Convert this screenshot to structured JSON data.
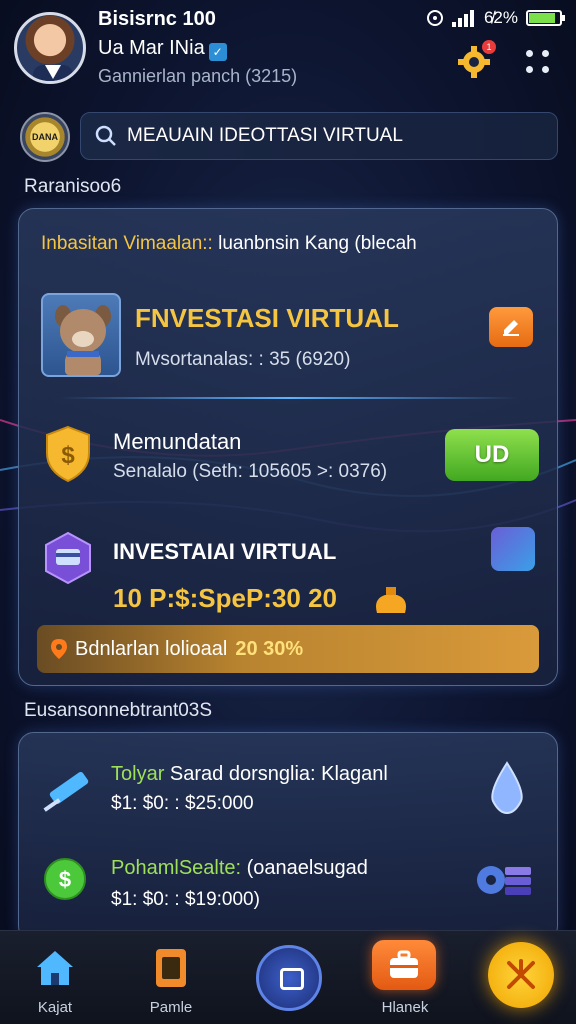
{
  "status_bar": {
    "signal_text": "6̸2%",
    "battery_level": 0.85
  },
  "header": {
    "title": "Bisisrnc 100",
    "name": "Ua Mar INia",
    "subtitle": "Gannierlan panch (3215)",
    "notification_badge": "1"
  },
  "search": {
    "logo_text": "DANA",
    "value": "MEAUAIN IDEOTTASI VIRTUAL"
  },
  "section1_title": "Raranisoo6",
  "card1": {
    "heading_highlight": "Inbasitan Vimaalan::",
    "heading_rest": " luanbnsin Kang (blecah",
    "item1": {
      "title": "FNVESTASI VIRTUAL",
      "subtitle": "Mvsortanalas: : 35 (6920)"
    },
    "item2": {
      "title": "Memundatan",
      "subtitle": "Senalalo (Seth: 105605 >: 0376)",
      "button_label": "UD"
    },
    "item3": {
      "title": "INVESTAIAI VIRTUAL",
      "value": "10 P:$:SpeP:30 20"
    },
    "promo": {
      "label": "Bdnlarlan lolioaal",
      "value": "20 30%"
    }
  },
  "section2_title": "Eusansonnebtrant03S",
  "card2": {
    "items": [
      {
        "title_highlight": "Tolyar",
        "title_rest": " Sarad dorsnglia: Klaganl",
        "price": "$1: $0: : $25:000"
      },
      {
        "title_highlight": "PohamlSealte:",
        "title_rest": " (oanaelsugad",
        "price": "$1: $0: : $19:000)"
      }
    ]
  },
  "bottom_nav": {
    "items": [
      {
        "label": "Kajat"
      },
      {
        "label": "Pamle"
      },
      {
        "label": ""
      },
      {
        "label": "Hlanek"
      }
    ]
  },
  "colors": {
    "accent_gold": "#f5c542",
    "accent_green": "#9ee05a",
    "button_green": "#42a821",
    "orange": "#e66b12",
    "background": "#0d1530"
  }
}
